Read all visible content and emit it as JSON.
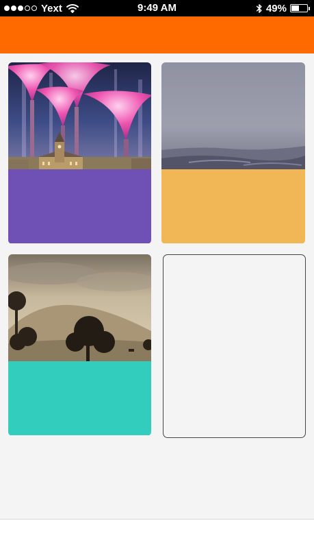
{
  "status_bar": {
    "signal_dots_filled": 3,
    "signal_dots_total": 5,
    "carrier": "Yext",
    "time": "9:49 AM",
    "battery_percent": "49%",
    "battery_level": 0.49,
    "icons": [
      "signal-dots",
      "wifi-icon",
      "bluetooth-icon",
      "battery-icon"
    ]
  },
  "colors": {
    "header": "#ff6a00",
    "background": "#f4f4f4",
    "card1_footer": "#6f50b5",
    "card2_footer": "#f1b757",
    "card3_footer": "#33cdbd"
  },
  "cards": [
    {
      "image": "pink canopy structures over a clock-tower building at dusk",
      "footer_color": "#6f50b5"
    },
    {
      "image": "foggy grey sea horizon",
      "footer_color": "#f1b757"
    },
    {
      "image": "sepia landscape of a grassy hill with oak trees",
      "footer_color": "#33cdbd"
    },
    {
      "image": "",
      "footer_color": ""
    }
  ]
}
